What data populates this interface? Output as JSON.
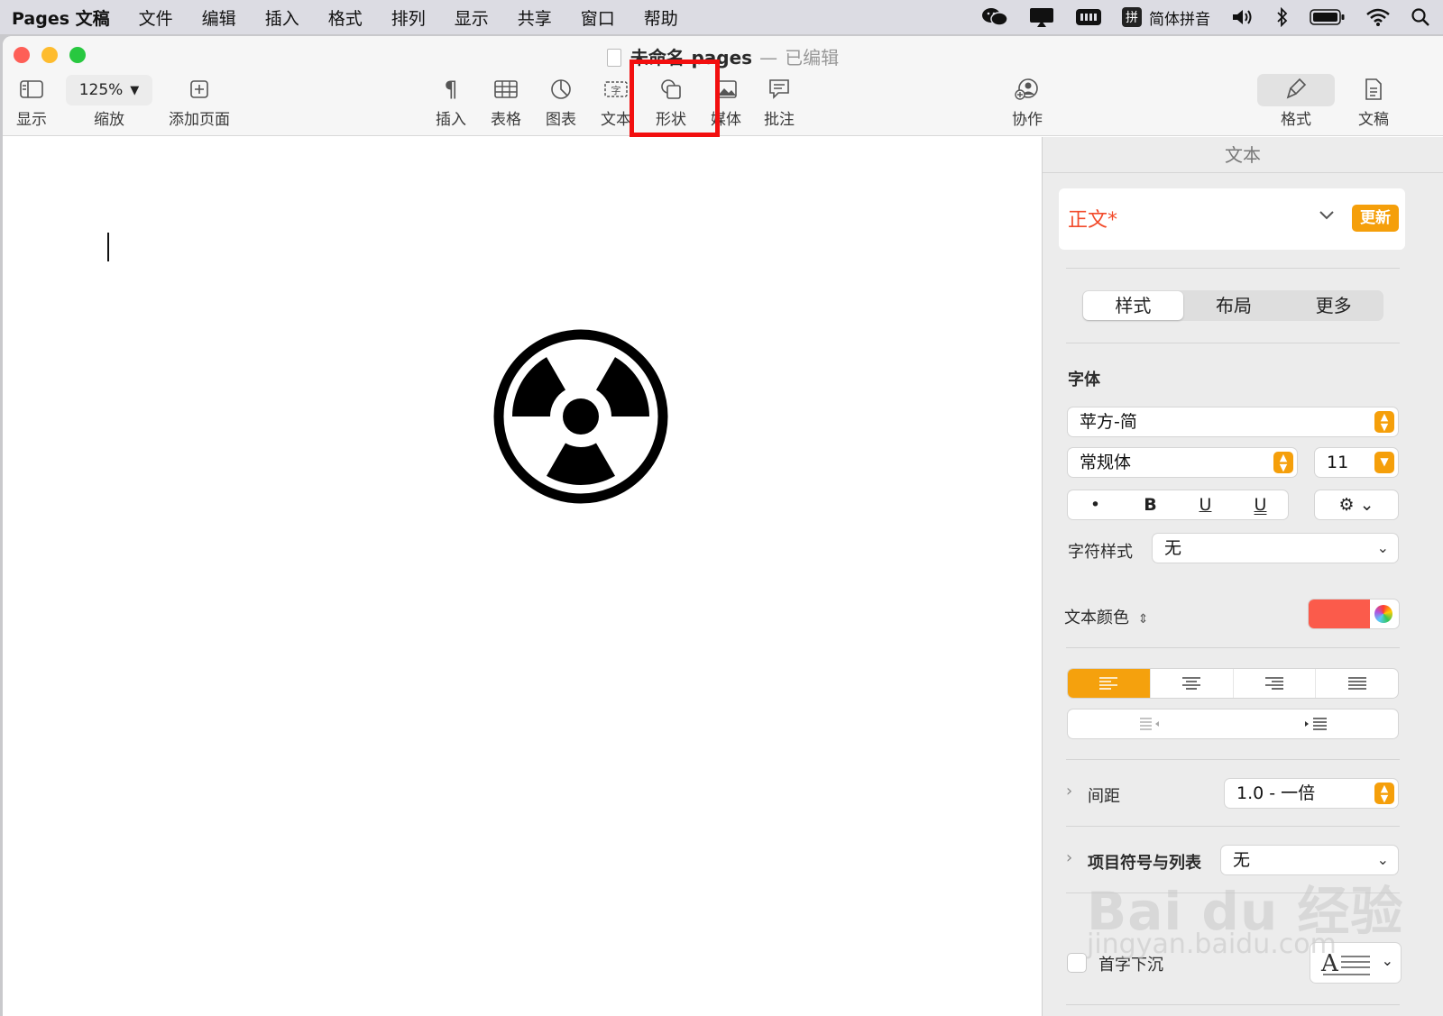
{
  "menubar": {
    "app": "Pages 文稿",
    "items": [
      "文件",
      "编辑",
      "插入",
      "格式",
      "排列",
      "显示",
      "共享",
      "窗口",
      "帮助"
    ],
    "ime_badge": "拼",
    "ime_label": "简体拼音"
  },
  "window": {
    "title": "未命名.pages",
    "title_sep": "—",
    "edited": "已编辑",
    "traffic_colors": [
      "#fe5f57",
      "#febc2e",
      "#28c840"
    ]
  },
  "toolbar": {
    "view_label": "显示",
    "zoom_value": "125%",
    "zoom_label": "缩放",
    "add_page_label": "添加页面",
    "insert_label": "插入",
    "table_label": "表格",
    "chart_label": "图表",
    "text_label": "文本",
    "shape_label": "形状",
    "media_label": "媒体",
    "comment_label": "批注",
    "collab_label": "协作",
    "format_label": "格式",
    "document_label": "文稿"
  },
  "highlight_color": "#f20f0f",
  "inspector": {
    "header": "文本",
    "paragraph_style": "正文*",
    "update_button": "更新",
    "tabs": [
      "样式",
      "布局",
      "更多"
    ],
    "font_section": "字体",
    "font_family": "苹方-简",
    "font_weight": "常规体",
    "font_size": "11",
    "char_style_label": "字符样式",
    "char_style_value": "无",
    "text_color_label": "文本颜色",
    "text_color": "#fb5b4b",
    "spacing_label": "间距",
    "spacing_value": "1.0 - 一倍",
    "bullets_label": "项目符号与列表",
    "bullets_value": "无",
    "dropcap_label": "首字下沉",
    "accent": "#f59f0a"
  },
  "watermark": {
    "text": "Bai du 经验",
    "url": "jingyan.baidu.com"
  }
}
